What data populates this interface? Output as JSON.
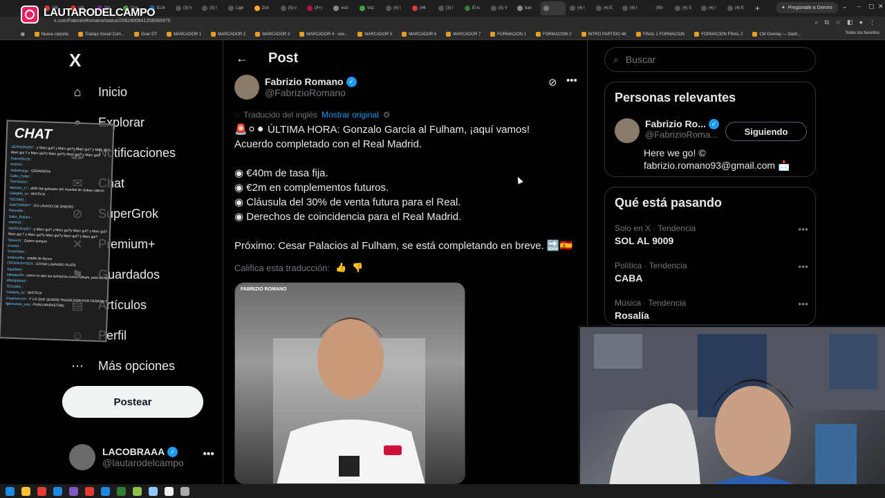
{
  "overlay": {
    "streamer_name": "LAUTARODELCAMPO"
  },
  "browser": {
    "tabs": [
      "(46",
      "(46",
      "We",
      "Ove",
      "ELN",
      "(3) h",
      "(3) I",
      "Lige",
      "Zon",
      "(5) v",
      "(9+)",
      "vozi",
      "Voz",
      "(4) I",
      "(46",
      "(3) I",
      "El ic",
      "(5) V",
      "ban",
      "",
      "(4) I",
      "(4) E",
      "(4) I",
      "(99-",
      "(4) S",
      "(4) I",
      "(4) E"
    ],
    "gemini_label": "Pregúntale a Gemini",
    "url": "x.com/FabrizioRomano/status/2082800841208086975",
    "bookmarks": [
      "Nueva carpeta",
      "Trabajo Social Com...",
      "Gran DT",
      "MARCADOR 1",
      "MARCADOR 2",
      "MARCADOR 3",
      "MARCADOR 4 - ove...",
      "MARCADOR 5",
      "MARCADOR 6",
      "MARCADOR 7",
      "FORMACION 1",
      "FORMACION 2",
      "INTRO PARTIDO 4K",
      "FINAL 1 FORMACION",
      "FORMACION FINAL 2",
      "CM Overlay — Dash..."
    ],
    "all_favorites": "Todos los favoritos"
  },
  "nav": {
    "logo": "X",
    "items": [
      {
        "label": "Inicio",
        "icon": "home-icon"
      },
      {
        "label": "Explorar",
        "icon": "search-icon"
      },
      {
        "label": "Notificaciones",
        "icon": "bell-icon"
      },
      {
        "label": "Chat",
        "icon": "chat-icon"
      },
      {
        "label": "SuperGrok",
        "icon": "grok-icon"
      },
      {
        "label": "Premium+",
        "icon": "x-premium-icon"
      },
      {
        "label": "Guardados",
        "icon": "bookmark-icon"
      },
      {
        "label": "Artículos",
        "icon": "article-icon"
      },
      {
        "label": "Perfil",
        "icon": "person-icon"
      },
      {
        "label": "Más opciones",
        "icon": "more-circle-icon"
      }
    ],
    "post_button": "Postear",
    "account": {
      "name": "LACOBRAAA",
      "handle": "@lautarodelcampo"
    }
  },
  "chat": {
    "title": "CHAT",
    "messages": [
      {
        "user": "GERSON1007",
        "text": "y Marc gui? y Marc gui?y Marc gui? y Marc gui?"
      },
      {
        "user": "",
        "text": "Marc gui ? y Marc gui?y Marc gui?y Marc gui? y Marc gui?"
      },
      {
        "user": "Pueneflex2b",
        "text": ""
      },
      {
        "user": "enzzzd",
        "text": ""
      },
      {
        "user": "Valentinagu",
        "text": "GRANDESA"
      },
      {
        "user": "Gabo_Fuller",
        "text": ""
      },
      {
        "user": "Scenclador",
        "text": ""
      },
      {
        "user": "fabasss_17",
        "text": "ahhh fue goleador del mundial de clubes cabrón"
      },
      {
        "user": "Gangsta_ez",
        "text": "MISTICA"
      },
      {
        "user": "TEO1901",
        "text": ""
      },
      {
        "user": "SANTOR8977",
        "text": "ES LAVADO DE DINERO"
      },
      {
        "user": "Rans484",
        "text": ""
      },
      {
        "user": "Gabo_Robles",
        "text": ""
      },
      {
        "user": "mehh23",
        "text": ""
      },
      {
        "user": "GERSON1007",
        "text": "y Marc gui? y Marc gui?y Marc gui? y Marc gui?"
      },
      {
        "user": "",
        "text": "Marc gui ? y Marc gui?y Marc gui?y Marc gui? y Marc gui?"
      },
      {
        "user": "SimonJz",
        "text": "Quiero queque"
      },
      {
        "user": "enzzzd",
        "text": ""
      },
      {
        "user": "Scenclador",
        "text": ""
      },
      {
        "user": "emanuelbo",
        "text": "estafa de época"
      },
      {
        "user": "CR7ENOFPDDS",
        "text": "ESTAN LAVANDO PLATA"
      },
      {
        "user": "Squidwrd",
        "text": ""
      },
      {
        "user": "lobojapo04",
        "text": "cómo no dan los sumamos con el fulham, para mí hay algo raro ahí"
      },
      {
        "user": "albergaaaad",
        "text": ""
      },
      {
        "user": "TEO1901",
        "text": ""
      },
      {
        "user": "Gangsta_ez",
        "text": "MISTICA"
      },
      {
        "user": "chapolacosm",
        "text": "Y LO QUE QUIERE PAGAR POR POR FERRÁN TORRES"
      },
      {
        "user": "fgfernando_ariq",
        "text": "PURO MARKETING"
      }
    ]
  },
  "post": {
    "header_title": "Post",
    "author_name": "Fabrizio Romano",
    "author_handle": "@FabrizioRomano",
    "translated_label": "Traducido del inglés",
    "show_original": "Mostrar original",
    "lines": [
      "🚨⚪⚫ ÚLTIMA HORA: Gonzalo García al Fulham, ¡aquí vamos!",
      "Acuerdo completado con el Real Madrid.",
      "",
      "◉ €40m de tasa fija.",
      "◉ €2m en complementos futuros.",
      "◉ Cláusula del 30% de venta futura para el Real.",
      "◉ Derechos de coincidencia para el Real Madrid.",
      "",
      "Próximo: Cesar Palacios al Fulham, se está completando en breve. 🔜🇪🇸"
    ],
    "rate_label": "Califica esta traducción:",
    "image_brand": "FABRIZIO ROMANO"
  },
  "sidebar": {
    "search_placeholder": "Buscar",
    "relevant_title": "Personas relevantes",
    "relevant_user": {
      "name": "Fabrizio Ro...",
      "handle": "@FabrizioRoma...",
      "follow_label": "Siguiendo",
      "bio_line1": "Here we go! ©",
      "bio_line2": "fabrizio.romano93@gmail.com 📩"
    },
    "trending_title": "Qué está pasando",
    "trends": [
      {
        "context": "Solo en X · Tendencia",
        "title": "SOL AL 9009"
      },
      {
        "context": "Política · Tendencia",
        "title": "CABA"
      },
      {
        "context": "Música · Tendencia",
        "title": "Rosalía"
      }
    ]
  },
  "colors": {
    "accent": "#1d9bf0",
    "background": "#000000",
    "text": "#e7e9ea",
    "muted": "#71767b"
  }
}
